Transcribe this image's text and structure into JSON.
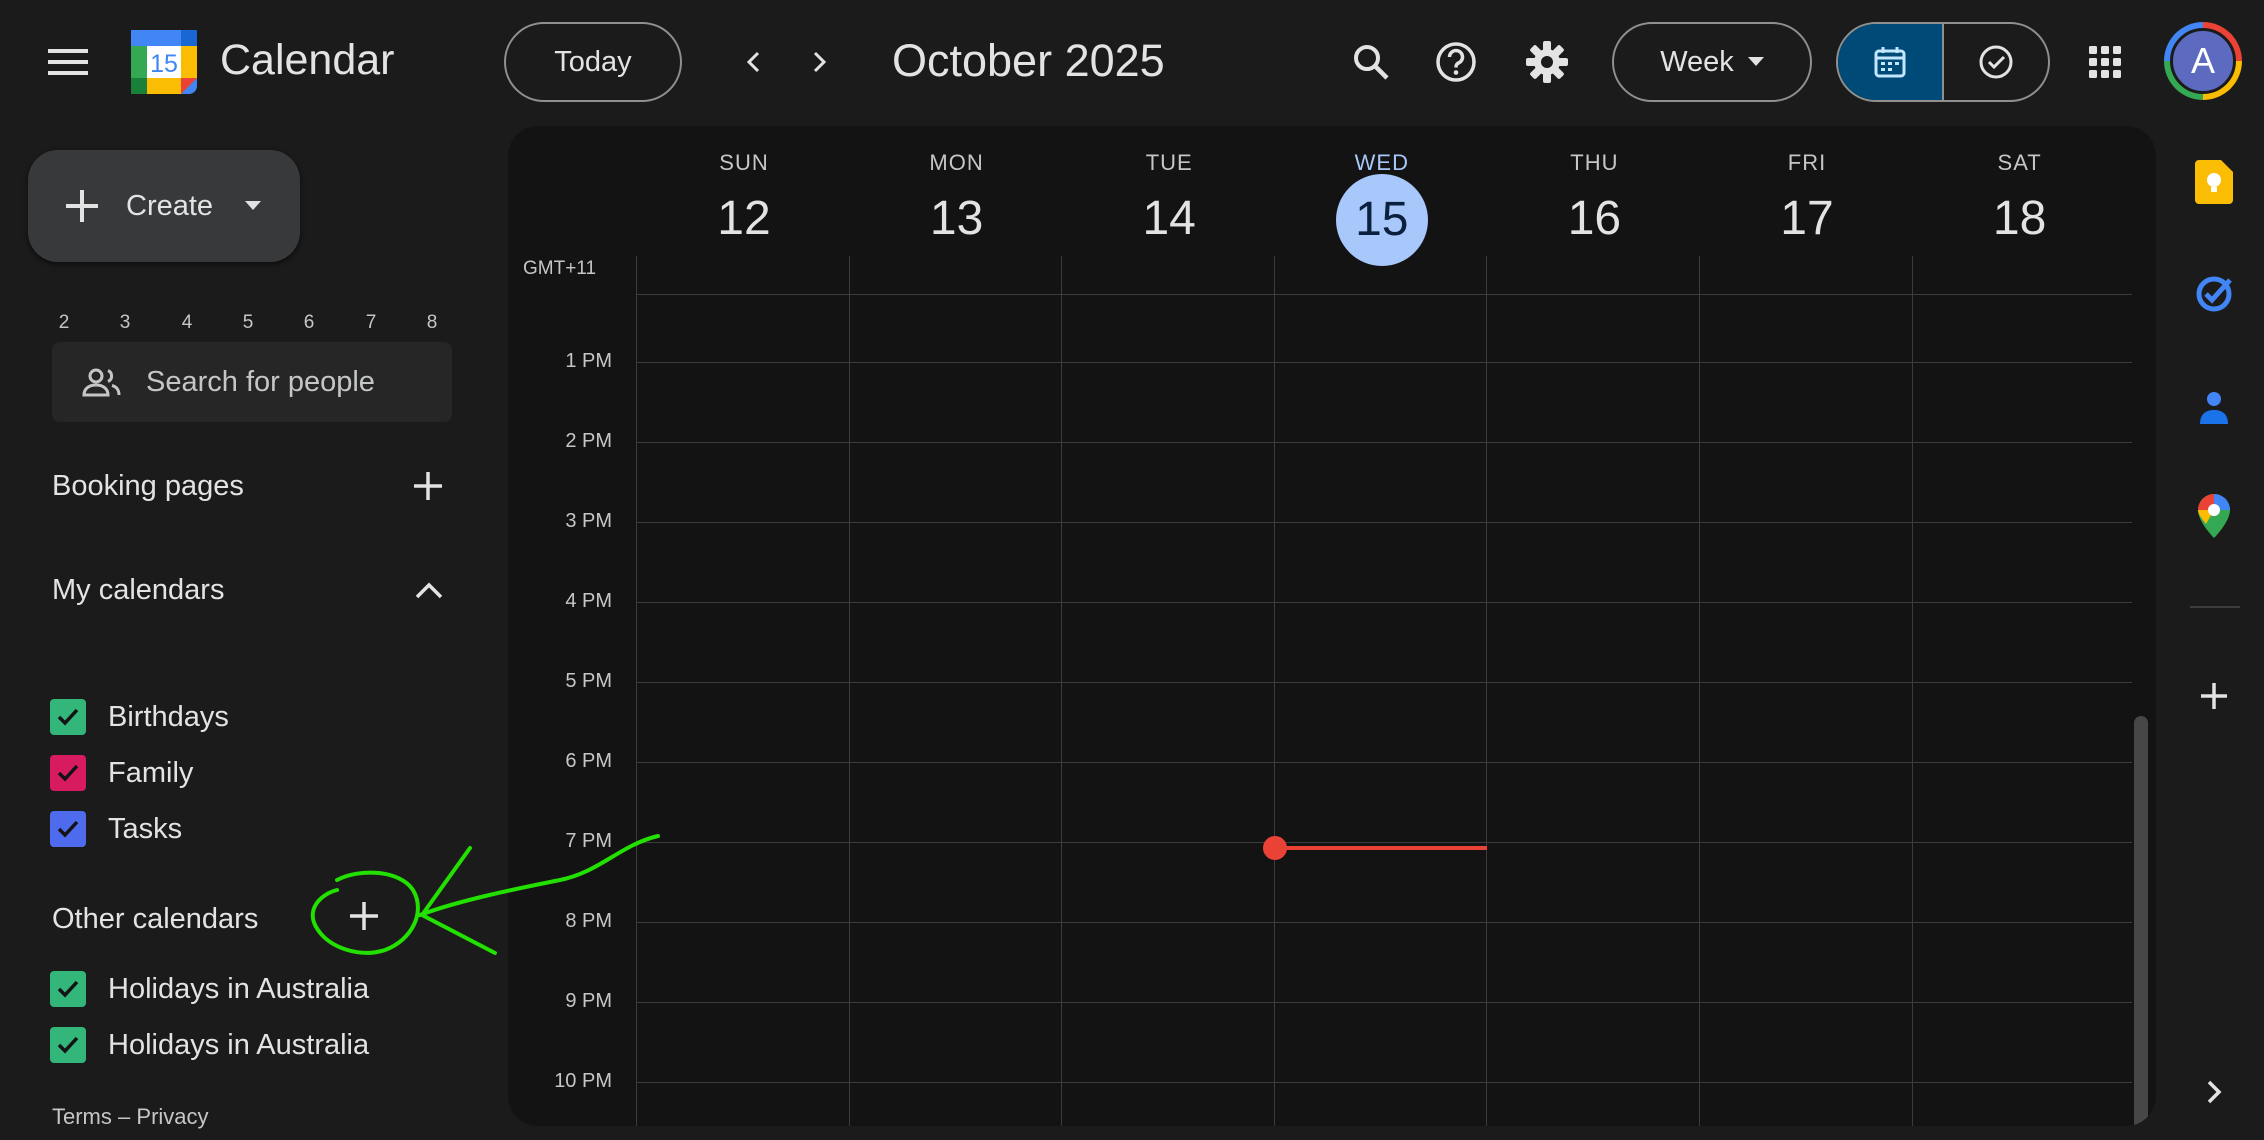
{
  "header": {
    "app_title": "Calendar",
    "logo_day": "15",
    "today_label": "Today",
    "period_title": "October 2025",
    "view_label": "Week",
    "avatar_letter": "A",
    "icons": [
      "main-menu-icon",
      "chevron-left-icon",
      "chevron-right-icon",
      "search-icon",
      "help-icon",
      "settings-icon",
      "chevron-down-icon",
      "calendar-view-icon",
      "tasks-view-icon",
      "apps-grid-icon"
    ]
  },
  "sidebar": {
    "create_label": "Create",
    "mini_calendar_days": [
      "2",
      "3",
      "4",
      "5",
      "6",
      "7",
      "8"
    ],
    "search_people_placeholder": "Search for people",
    "booking_pages_label": "Booking pages",
    "my_calendars_label": "My calendars",
    "my_calendars": [
      {
        "label": "Birthdays",
        "color": "#33b679",
        "checked": true
      },
      {
        "label": "Family",
        "color": "#d81b60",
        "checked": true
      },
      {
        "label": "Tasks",
        "color": "#4f6bed",
        "checked": true
      }
    ],
    "other_calendars_label": "Other calendars",
    "other_calendars": [
      {
        "label": "Holidays in Australia",
        "color": "#33b679",
        "checked": true
      },
      {
        "label": "Holidays in Australia",
        "color": "#33b679",
        "checked": true
      }
    ],
    "footer": {
      "terms": "Terms",
      "separator": "–",
      "privacy": "Privacy"
    }
  },
  "week": {
    "timezone": "GMT+11",
    "days": [
      {
        "dow": "SUN",
        "date": "12",
        "today": false
      },
      {
        "dow": "MON",
        "date": "13",
        "today": false
      },
      {
        "dow": "TUE",
        "date": "14",
        "today": false
      },
      {
        "dow": "WED",
        "date": "15",
        "today": true
      },
      {
        "dow": "THU",
        "date": "16",
        "today": false
      },
      {
        "dow": "FRI",
        "date": "17",
        "today": false
      },
      {
        "dow": "SAT",
        "date": "18",
        "today": false
      }
    ],
    "hours": [
      "1 PM",
      "2 PM",
      "3 PM",
      "4 PM",
      "5 PM",
      "6 PM",
      "7 PM",
      "8 PM",
      "9 PM",
      "10 PM"
    ],
    "current_time_indicator_color": "#ea4335"
  },
  "right_rail": {
    "icons": [
      "keep-icon",
      "google-tasks-icon",
      "contacts-icon",
      "maps-icon",
      "add-addon-icon",
      "expand-panel-icon"
    ]
  },
  "annotation": {
    "color": "#22e000",
    "target": "Other calendars add button"
  },
  "colors": {
    "background": "#1b1b1b",
    "grid_panel": "#131313",
    "accent": "#a8c7fa",
    "selected_toggle": "#004a77"
  }
}
